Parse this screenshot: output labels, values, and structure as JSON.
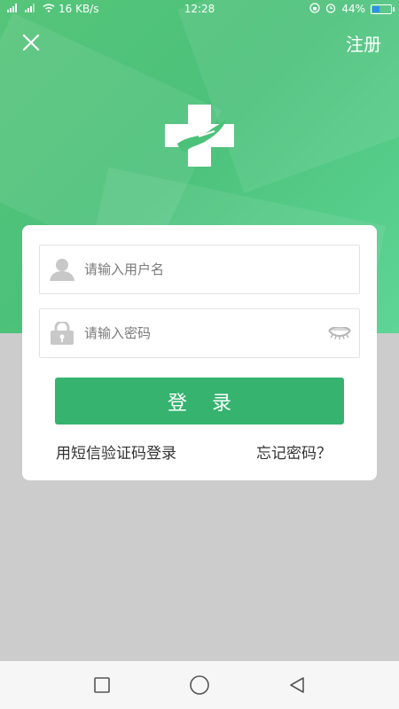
{
  "status_bar": {
    "signal_1": "4G",
    "signal_2": "2G",
    "network_speed": "16 KB/s",
    "time": "12:28",
    "battery_percent": "44%",
    "battery_level": 0.44
  },
  "header": {
    "close_icon": "close-icon",
    "register_label": "注册"
  },
  "logo": {
    "icon": "medical-cross-hand-icon",
    "colors": {
      "primary": "#4cc17a",
      "white": "#ffffff"
    }
  },
  "form": {
    "username": {
      "placeholder": "请输入用户名",
      "value": "",
      "icon": "user-icon"
    },
    "password": {
      "placeholder": "请输入密码",
      "value": "",
      "icon": "lock-icon",
      "toggle_icon": "eye-closed-icon"
    },
    "login_label": "登录",
    "sms_login_label": "用短信验证码登录",
    "forgot_password_label": "忘记密码？"
  },
  "nav_bar": {
    "recent_icon": "square-icon",
    "home_icon": "circle-icon",
    "back_icon": "triangle-back-icon"
  },
  "colors": {
    "accent": "#35b36f",
    "hero": "#4cc17a",
    "background": "#cccccc"
  }
}
